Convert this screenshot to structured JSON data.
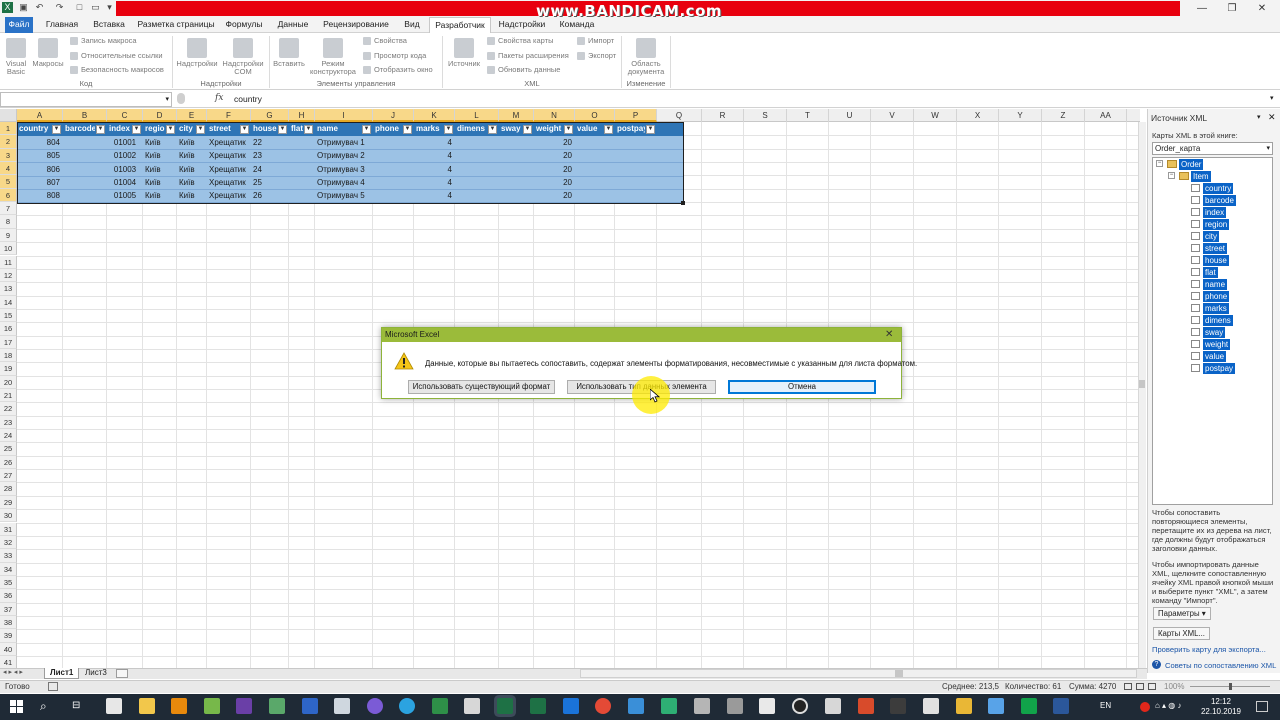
{
  "watermark": "www.BANDICAM.com",
  "ribbon_tabs": [
    "Файл",
    "Главная",
    "Вставка",
    "Разметка страницы",
    "Формулы",
    "Данные",
    "Рецензирование",
    "Вид",
    "Разработчик",
    "Надстройки",
    "Команда"
  ],
  "ribbon": {
    "code": {
      "vba": "Visual Basic",
      "macros": "Макросы",
      "record": "Запись макроса",
      "relative": "Относительные ссылки",
      "security": "Безопасность макросов",
      "label": "Код"
    },
    "addins": {
      "addins": "Надстройки",
      "com": "Надстройки COM",
      "label": "Надстройки"
    },
    "controls": {
      "insert": "Вставить",
      "design": "Режим конструктора",
      "props": "Свойства",
      "view_code": "Просмотр кода",
      "dialog": "Отобразить окно",
      "label": "Элементы управления"
    },
    "xml": {
      "source": "Источник",
      "map_props": "Свойства карты",
      "packs": "Пакеты расширения",
      "refresh": "Обновить данные",
      "import": "Импорт",
      "export": "Экспорт",
      "label": "XML"
    },
    "modify": {
      "doc_panel": "Область документа",
      "label": "Изменение"
    }
  },
  "formula_bar": {
    "fx": "fx",
    "content": "country"
  },
  "columns": [
    "A",
    "B",
    "C",
    "D",
    "E",
    "F",
    "G",
    "H",
    "I",
    "J",
    "K",
    "L",
    "M",
    "N",
    "O",
    "P",
    "Q",
    "R",
    "S",
    "T",
    "U",
    "V",
    "W",
    "X",
    "Y",
    "Z",
    "AA"
  ],
  "rows": [
    "1",
    "2",
    "3",
    "4",
    "5",
    "6",
    "7",
    "8",
    "9",
    "10",
    "11",
    "12",
    "13",
    "14",
    "15",
    "16",
    "17",
    "18",
    "19",
    "20",
    "21",
    "22",
    "23",
    "24",
    "25",
    "26",
    "27",
    "28",
    "29",
    "30",
    "31",
    "32",
    "33",
    "34",
    "35",
    "36",
    "37",
    "38",
    "39",
    "40",
    "41"
  ],
  "table": {
    "headers": [
      "country",
      "barcode",
      "index",
      "region",
      "city",
      "street",
      "house",
      "flat",
      "name",
      "phone",
      "marks",
      "dimens",
      "sway",
      "weight",
      "value",
      "postpay"
    ],
    "rows": [
      [
        "804",
        "",
        "01001",
        "Київ",
        "Київ",
        "Хрещатик",
        "22",
        "",
        "Отримувач 1",
        "",
        "4",
        "",
        "",
        "20",
        "",
        ""
      ],
      [
        "805",
        "",
        "01002",
        "Київ",
        "Київ",
        "Хрещатик",
        "23",
        "",
        "Отримувач 2",
        "",
        "4",
        "",
        "",
        "20",
        "",
        ""
      ],
      [
        "806",
        "",
        "01003",
        "Київ",
        "Київ",
        "Хрещатик",
        "24",
        "",
        "Отримувач 3",
        "",
        "4",
        "",
        "",
        "20",
        "",
        ""
      ],
      [
        "807",
        "",
        "01004",
        "Київ",
        "Київ",
        "Хрещатик",
        "25",
        "",
        "Отримувач 4",
        "",
        "4",
        "",
        "",
        "20",
        "",
        ""
      ],
      [
        "808",
        "",
        "01005",
        "Київ",
        "Київ",
        "Хрещатик",
        "26",
        "",
        "Отримувач 5",
        "",
        "4",
        "",
        "",
        "20",
        "",
        ""
      ]
    ]
  },
  "dialog": {
    "title": "Microsoft Excel",
    "message": "Данные, которые вы пытаетесь сопоставить, содержат элементы форматирования, несовместимые с указанным для листа форматом.",
    "btn_existing": "Использовать существующий формат",
    "btn_type": "Использовать тип данных элемента",
    "btn_cancel": "Отмена"
  },
  "pane": {
    "title": "Источник XML",
    "maps_label": "Карты XML в этой книге:",
    "map_selected": "Order_карта",
    "tree": [
      "Order",
      "Item",
      "country",
      "barcode",
      "index",
      "region",
      "city",
      "street",
      "house",
      "flat",
      "name",
      "phone",
      "marks",
      "dimens",
      "sway",
      "weight",
      "value",
      "postpay"
    ],
    "note1": "Чтобы сопоставить повторяющиеся элементы, перетащите их из дерева на лист, где должны будут отображаться заголовки данных.",
    "note2": "Чтобы импортировать данные XML, щелкните сопоставленную ячейку XML правой кнопкой мыши и выберите пункт \"XML\", а затем команду \"Импорт\".",
    "params_btn": "Параметры ▾",
    "maps_btn": "Карты XML...",
    "link_check": "Проверить карту для экспорта...",
    "link_tips": "Советы по сопоставлению XML"
  },
  "sheets": [
    "Лист1",
    "Лист3"
  ],
  "status": {
    "ready": "Готово",
    "avg": "Среднее: 213,5",
    "count": "Количество: 61",
    "sum": "Сумма: 4270",
    "zoom": "100%"
  },
  "taskbar": {
    "lang": "EN",
    "time": "12:12",
    "date": "22.10.2019"
  }
}
